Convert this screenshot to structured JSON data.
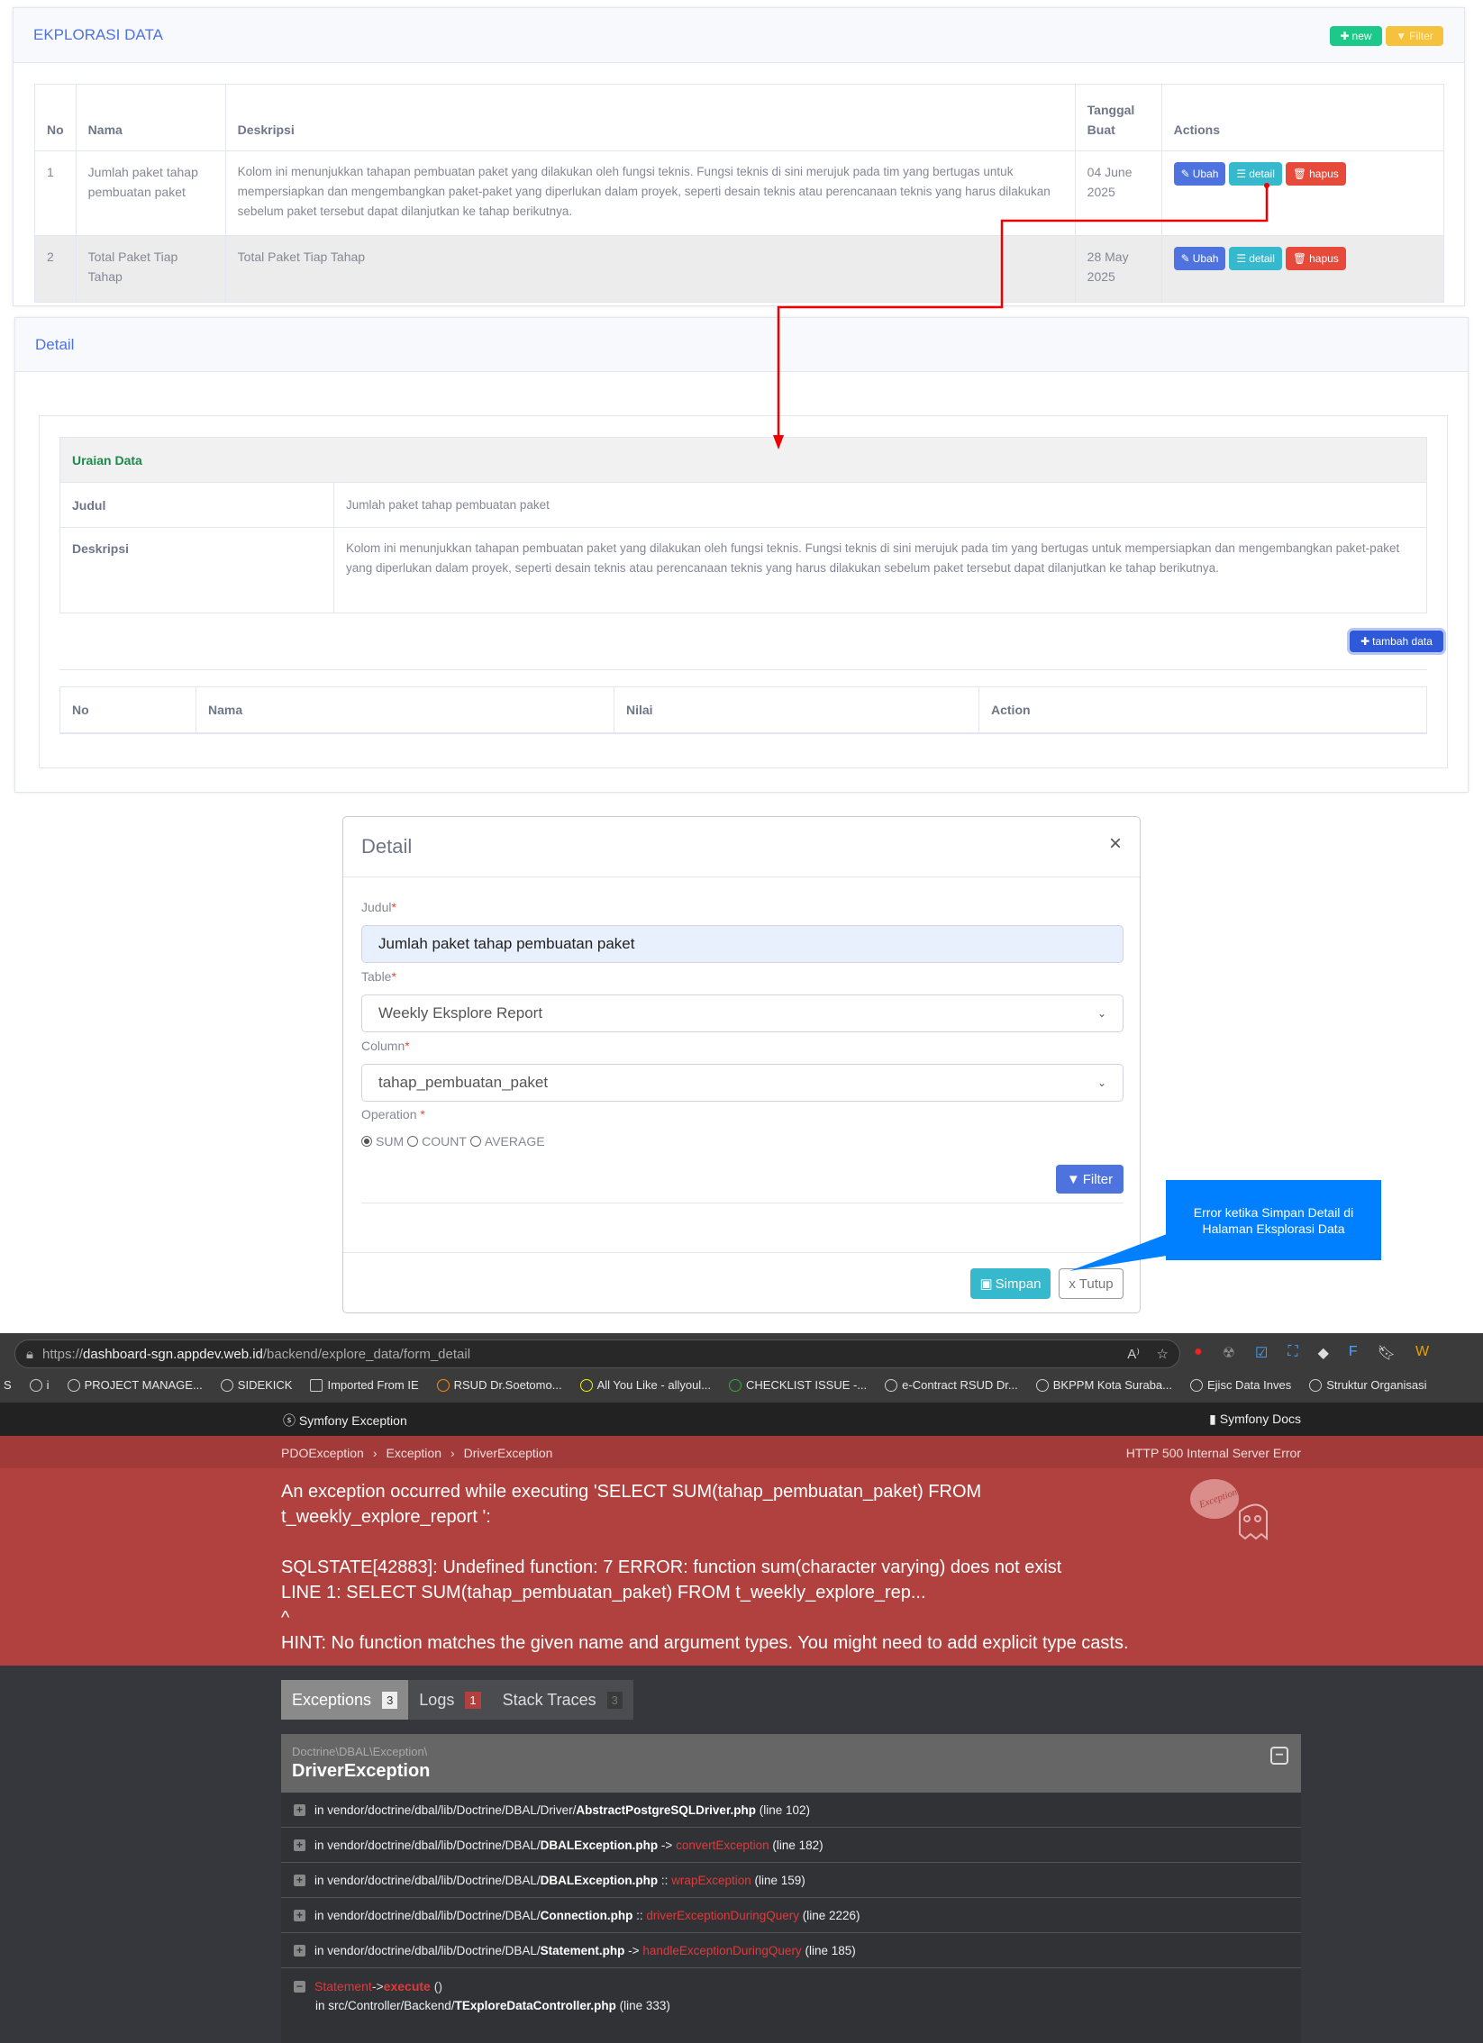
{
  "list_card": {
    "title": "EKPLORASI DATA",
    "new_label": "new",
    "filter_label": "Filter",
    "headers": [
      "No",
      "Nama",
      "Deskripsi",
      "Tanggal Buat",
      "Actions"
    ],
    "rows": [
      {
        "no": "1",
        "nama": "Jumlah paket tahap pembuatan paket",
        "deskripsi": "Kolom ini menunjukkan tahapan pembuatan paket yang dilakukan oleh fungsi teknis. Fungsi teknis di sini merujuk pada tim yang bertugas untuk mempersiapkan dan mengembangkan paket-paket yang diperlukan dalam proyek, seperti desain teknis atau perencanaan teknis yang harus dilakukan sebelum paket tersebut dapat dilanjutkan ke tahap berikutnya.",
        "tanggal": "04 June 2025"
      },
      {
        "no": "2",
        "nama": "Total Paket Tiap Tahap",
        "deskripsi": "Total Paket Tiap Tahap",
        "tanggal": "28 May 2025"
      }
    ],
    "actions": {
      "edit": "Ubah",
      "detail": "detail",
      "delete": "hapus"
    }
  },
  "detail_card": {
    "title": "Detail",
    "section": "Uraian Data",
    "judul_label": "Judul",
    "judul_value": "Jumlah paket tahap pembuatan paket",
    "deskripsi_label": "Deskripsi",
    "deskripsi_value": "Kolom ini menunjukkan tahapan pembuatan paket yang dilakukan oleh fungsi teknis. Fungsi teknis di sini merujuk pada tim yang bertugas untuk mempersiapkan dan mengembangkan paket-paket yang diperlukan dalam proyek, seperti desain teknis atau perencanaan teknis yang harus dilakukan sebelum paket tersebut dapat dilanjutkan ke tahap berikutnya.",
    "add_label": "tambah data",
    "headers": [
      "No",
      "Nama",
      "Nilai",
      "Action"
    ]
  },
  "modal": {
    "title": "Detail",
    "close": "×",
    "judul_label": "Judul",
    "judul_value": "Jumlah paket tahap pembuatan paket",
    "table_label": "Table",
    "table_value": "Weekly Eksplore Report",
    "column_label": "Column",
    "column_value": "tahap_pembuatan_paket",
    "operation_label": "Operation",
    "required": "*",
    "operations": [
      "SUM",
      "COUNT",
      "AVERAGE"
    ],
    "selected_operation": "SUM",
    "filter_label": "Filter",
    "save_label": "Simpan",
    "close_label": "x Tutup"
  },
  "callout": {
    "text": "Error ketika Simpan Detail di Halaman Eksplorasi Data",
    "color": "#0080ff"
  },
  "browser": {
    "url_prefix": "https://",
    "url_host": "dashboard-sgn.appdev.web.id",
    "url_path": "/backend/explore_data/form_detail",
    "bookmarks": [
      "S",
      "i",
      "PROJECT MANAGE...",
      "SIDEKICK",
      "Imported From IE",
      "RSUD Dr.Soetomo...",
      "All You Like - allyoul...",
      "CHECKLIST ISSUE -...",
      "e-Contract RSUD Dr...",
      "BKPPM Kota Suraba...",
      "Ejisc Data Inves",
      "Struktur Organisasi"
    ]
  },
  "symfony": {
    "brand": "Symfony Exception",
    "docs": "Symfony Docs",
    "breadcrumb": [
      "PDOException",
      "Exception",
      "DriverException"
    ],
    "status": "HTTP 500 Internal Server Error",
    "message": [
      "An exception occurred while executing 'SELECT SUM(tahap_pembuatan_paket) FROM",
      "t_weekly_explore_report ':",
      "",
      "SQLSTATE[42883]: Undefined function: 7 ERROR: function sum(character varying) does not exist",
      "LINE 1: SELECT SUM(tahap_pembuatan_paket) FROM t_weekly_explore_rep...",
      "^",
      "HINT: No function matches the given name and argument types. You might need to add explicit type casts."
    ],
    "ghost_text": "Exception!",
    "tabs": [
      {
        "label": "Exceptions",
        "count": "3"
      },
      {
        "label": "Logs",
        "count": "1"
      },
      {
        "label": "Stack Traces",
        "count": "3"
      }
    ],
    "exception_ns": "Doctrine\\DBAL\\Exception\\",
    "exception_class": "DriverException",
    "trace": [
      {
        "path": "in vendor/doctrine/dbal/lib/Doctrine/DBAL/Driver/",
        "file": "AbstractPostgreSQLDriver.php",
        "sep": "",
        "fn": "",
        "line": "(line 102)"
      },
      {
        "path": "in vendor/doctrine/dbal/lib/Doctrine/DBAL/",
        "file": "DBALException.php",
        "sep": "->",
        "fn": "convertException",
        "line": "(line 182)"
      },
      {
        "path": "in vendor/doctrine/dbal/lib/Doctrine/DBAL/",
        "file": "DBALException.php",
        "sep": "::",
        "fn": "wrapException",
        "line": "(line 159)"
      },
      {
        "path": "in vendor/doctrine/dbal/lib/Doctrine/DBAL/",
        "file": "Connection.php",
        "sep": "::",
        "fn": "driverExceptionDuringQuery",
        "line": "(line 2226)"
      },
      {
        "path": "in vendor/doctrine/dbal/lib/Doctrine/DBAL/",
        "file": "Statement.php",
        "sep": "->",
        "fn": "handleExceptionDuringQuery",
        "line": "(line 185)"
      }
    ],
    "open_trace": {
      "cls": "Statement",
      "sep": "->",
      "fn": "execute",
      "args": "()",
      "path": "in src/Controller/Backend/",
      "file": "TExploreDataController.php",
      "line": "(line 333)"
    }
  }
}
